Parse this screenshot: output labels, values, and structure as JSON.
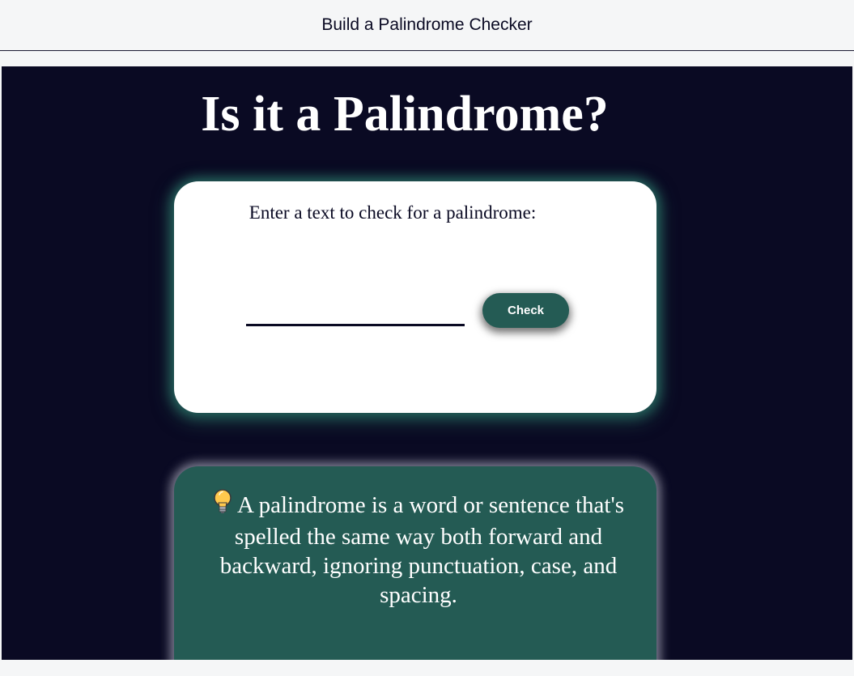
{
  "window": {
    "title": "Build a Palindrome Checker"
  },
  "main": {
    "heading": "Is it a Palindrome?",
    "form": {
      "label": "Enter a text to check for a palindrome:",
      "input_value": "",
      "input_placeholder": "",
      "check_button_label": "Check"
    },
    "info": {
      "icon": "lightbulb-icon",
      "text": "A palindrome is a word or sentence that's spelled the same way both forward and backward, ignoring punctuation, case, and spacing."
    }
  },
  "colors": {
    "page_background": "#0a0a23",
    "accent": "#245b54",
    "card_background": "#ffffff",
    "topbar_background": "#f5f6f7"
  }
}
